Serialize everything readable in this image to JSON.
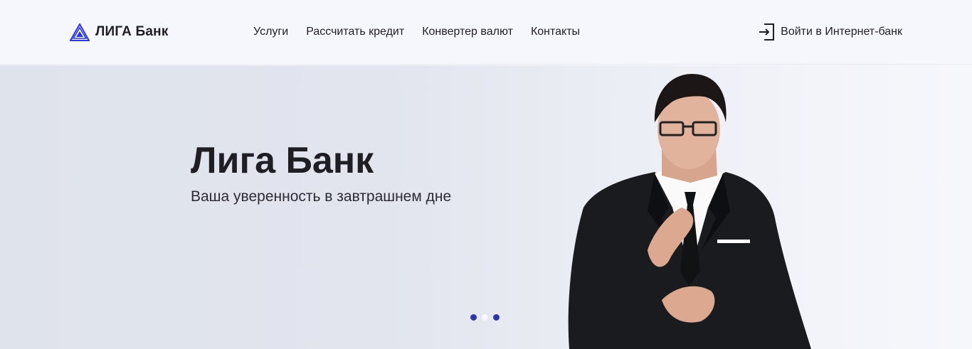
{
  "header": {
    "logo": {
      "text": "ЛИГА Банк",
      "icon": "triangle-logo-icon",
      "color": "#2c36f2"
    },
    "nav": [
      {
        "label": "Услуги"
      },
      {
        "label": "Рассчитать кредит"
      },
      {
        "label": "Конвертер валют"
      },
      {
        "label": "Контакты"
      }
    ],
    "login": {
      "label": "Войти в Интернет-банк",
      "icon": "login-icon"
    }
  },
  "hero": {
    "title": "Лига Банк",
    "subtitle": "Ваша уверенность в завтрашнем дне",
    "slider": {
      "dots": [
        {
          "active": false,
          "color": "#2c36a8"
        },
        {
          "active": true,
          "color": "#f6f7ff"
        },
        {
          "active": false,
          "color": "#2c36a8"
        }
      ]
    },
    "image": "businessman-photo"
  }
}
